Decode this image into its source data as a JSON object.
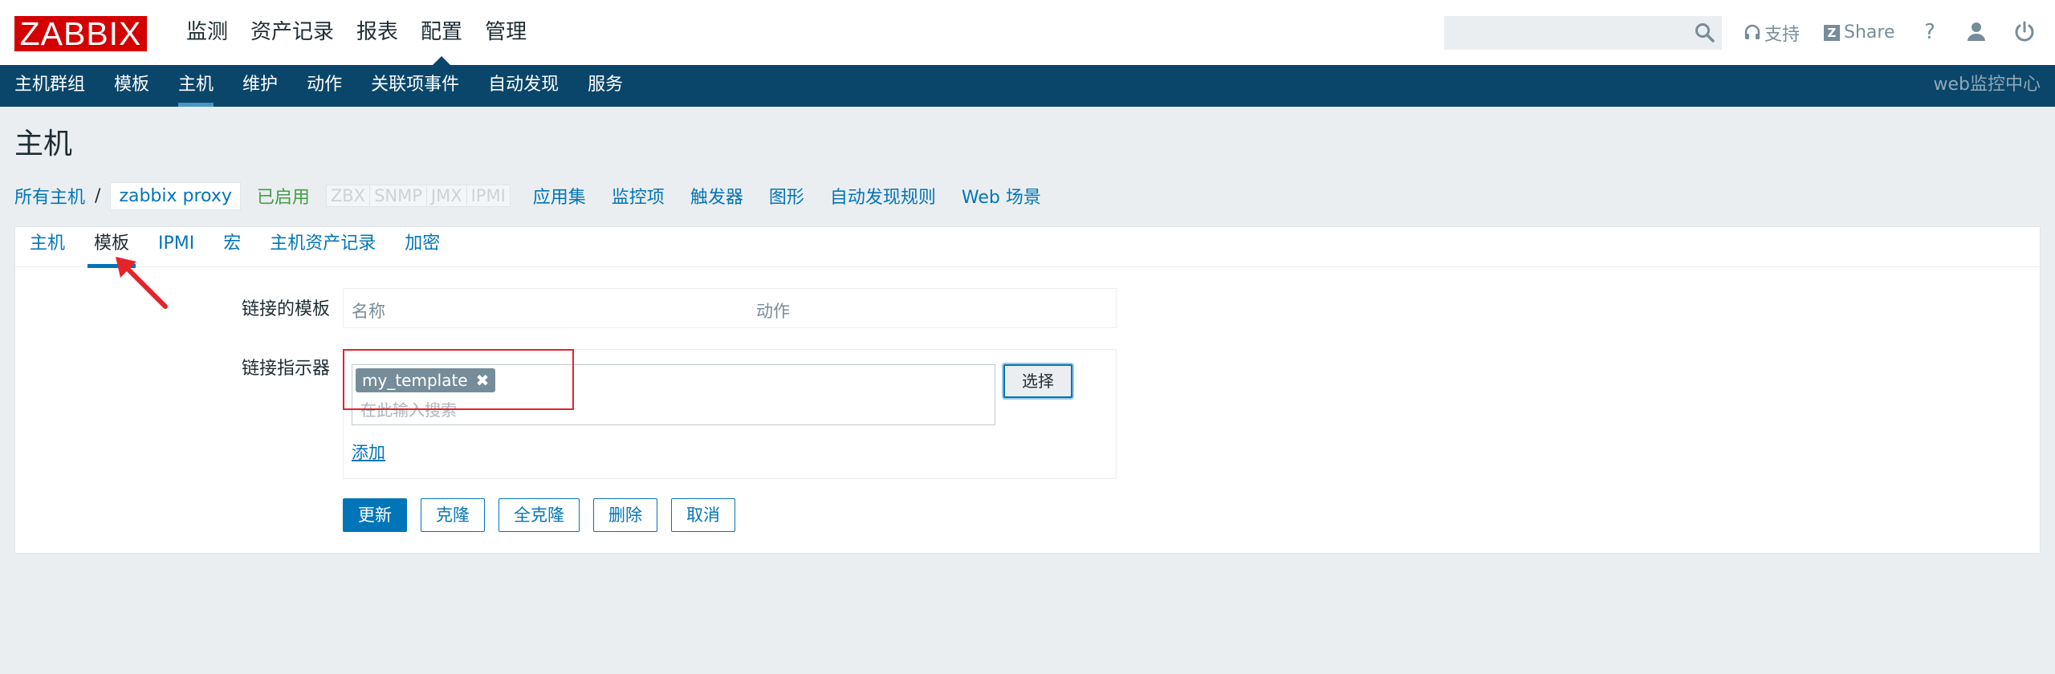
{
  "app": {
    "logo_text": "ZABBIX",
    "brand_color": "#d40000",
    "accent_color": "#0275b8"
  },
  "main_menu": [
    {
      "label": "监测"
    },
    {
      "label": "资产记录"
    },
    {
      "label": "报表"
    },
    {
      "label": "配置",
      "selected": true
    },
    {
      "label": "管理"
    }
  ],
  "header_right": {
    "search_value": "",
    "support_label": "支持",
    "share_label": "Share",
    "help_label": "?"
  },
  "sub_menu": [
    {
      "label": "主机群组"
    },
    {
      "label": "模板"
    },
    {
      "label": "主机",
      "selected": true
    },
    {
      "label": "维护"
    },
    {
      "label": "动作"
    },
    {
      "label": "关联项事件"
    },
    {
      "label": "自动发现"
    },
    {
      "label": "服务"
    }
  ],
  "server_name": "web监控中心",
  "page_title": "主机",
  "breadcrumb": {
    "all_hosts": "所有主机",
    "separator": "/",
    "current_host": "zabbix proxy",
    "status": "已启用",
    "availability": [
      "ZBX",
      "SNMP",
      "JMX",
      "IPMI"
    ],
    "links": [
      "应用集",
      "监控项",
      "触发器",
      "图形",
      "自动发现规则",
      "Web 场景"
    ]
  },
  "tabs": [
    {
      "label": "主机"
    },
    {
      "label": "模板",
      "active": true
    },
    {
      "label": "IPMI"
    },
    {
      "label": "宏"
    },
    {
      "label": "主机资产记录"
    },
    {
      "label": "加密"
    }
  ],
  "form": {
    "linked_templates_label": "链接的模板",
    "linked_columns": {
      "name": "名称",
      "action": "动作"
    },
    "link_new_label": "链接指示器",
    "selected_template": "my_template",
    "search_placeholder": "在此输入搜索",
    "select_button": "选择",
    "add_link": "添加"
  },
  "buttons": {
    "update": "更新",
    "clone": "克隆",
    "full_clone": "全克隆",
    "delete": "删除",
    "cancel": "取消"
  },
  "annotation_colors": {
    "highlight_box": "#e4232b",
    "arrow": "#e4232b"
  }
}
